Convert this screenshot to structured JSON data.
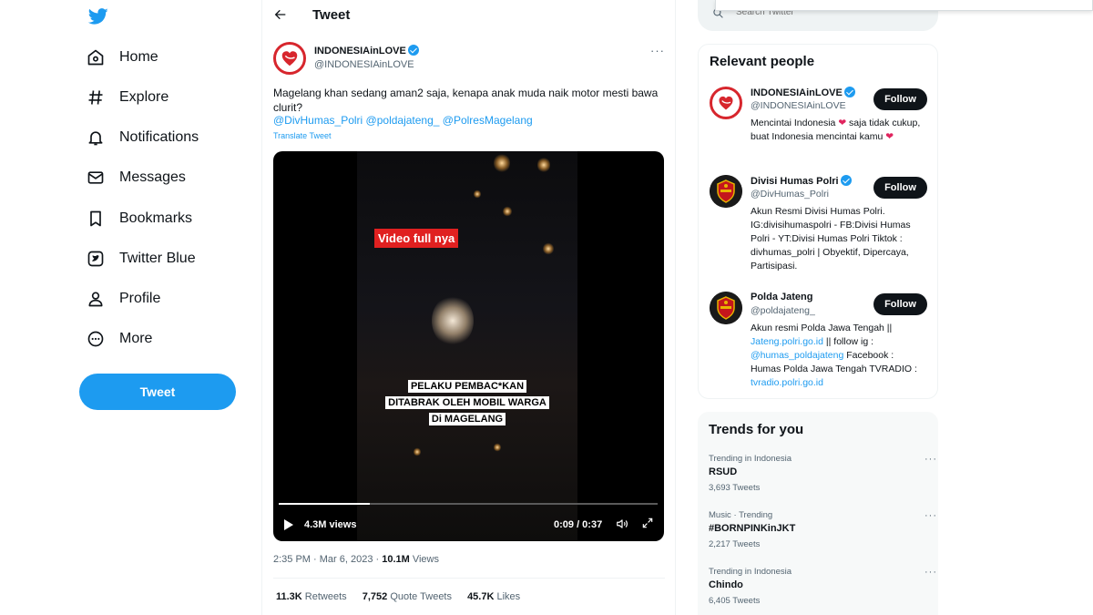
{
  "nav": {
    "logo": "twitter-bird-icon",
    "items": [
      {
        "label": "Home",
        "icon": "home-icon"
      },
      {
        "label": "Explore",
        "icon": "hashtag-icon"
      },
      {
        "label": "Notifications",
        "icon": "bell-icon"
      },
      {
        "label": "Messages",
        "icon": "envelope-icon"
      },
      {
        "label": "Bookmarks",
        "icon": "bookmark-icon"
      },
      {
        "label": "Twitter Blue",
        "icon": "twitter-blue-icon"
      },
      {
        "label": "Profile",
        "icon": "person-icon"
      },
      {
        "label": "More",
        "icon": "more-circle-icon"
      }
    ],
    "tweet_button": "Tweet"
  },
  "header": {
    "title": "Tweet"
  },
  "tweet": {
    "author_name": "INDONESIAinLOVE",
    "author_handle": "@INDONESIAinLOVE",
    "text": "Magelang khan sedang aman2 saja, kenapa anak muda naik motor mesti bawa clurit?",
    "mentions": "@DivHumas_Polri @poldajateng_ @PolresMagelang",
    "translate": "Translate Tweet",
    "video": {
      "overlay_tag": "Video full nya",
      "caption_lines": [
        "PELAKU PEMBAC*KAN",
        "DITABRAK OLEH MOBIL WARGA",
        "Di MAGELANG"
      ],
      "views": "4.3M views",
      "time": "0:09 / 0:37",
      "progress": 0.24
    },
    "timestamp": "2:35 PM · Mar 6, 2023 · ",
    "view_count": "10.1M",
    "view_label": " Views",
    "retweets": "11.3K",
    "retweets_label": " Retweets",
    "quote_tweets": "7,752",
    "quote_label": " Quote Tweets",
    "likes": "45.7K",
    "likes_label": " Likes"
  },
  "search": {
    "placeholder": "Search Twitter"
  },
  "relevant": {
    "title": "Relevant people",
    "people": [
      {
        "name": "INDONESIAinLOVE",
        "handle": "@INDONESIAinLOVE",
        "follow": "Follow",
        "bio_a": "Mencintai Indonesia ",
        "bio_b": " saja tidak cukup, buat Indonesia mencintai kamu "
      },
      {
        "name": "Divisi Humas Polri",
        "handle": "@DivHumas_Polri",
        "follow": "Follow",
        "bio": "Akun Resmi Divisi Humas Polri. IG:divisihumaspolri - FB:Divisi Humas Polri - YT:Divisi Humas Polri Tiktok : divhumas_polri | Obyektif, Dipercaya, Partisipasi."
      },
      {
        "name": "Polda Jateng",
        "handle": "@poldajateng_",
        "follow": "Follow",
        "bio_a": "Akun resmi Polda Jawa Tengah || ",
        "link1": "Jateng.polri.go.id",
        "bio_b": " || follow ig : ",
        "link2": "@humas_poldajateng",
        "bio_c": " Facebook : Humas Polda Jawa Tengah TVRADIO : ",
        "link3": "tvradio.polri.go.id"
      }
    ]
  },
  "trends": {
    "title": "Trends for you",
    "items": [
      {
        "context": "Trending in Indonesia",
        "name": "RSUD",
        "count": "3,693 Tweets"
      },
      {
        "context": "Music · Trending",
        "name": "#BORNPINKinJKT",
        "count": "2,217 Tweets"
      },
      {
        "context": "Trending in Indonesia",
        "name": "Chindo",
        "count": "6,405 Tweets"
      }
    ]
  },
  "colors": {
    "accent": "#1d9bf0",
    "text": "#0f1419",
    "muted": "#536471",
    "heart": "#e0245e"
  }
}
